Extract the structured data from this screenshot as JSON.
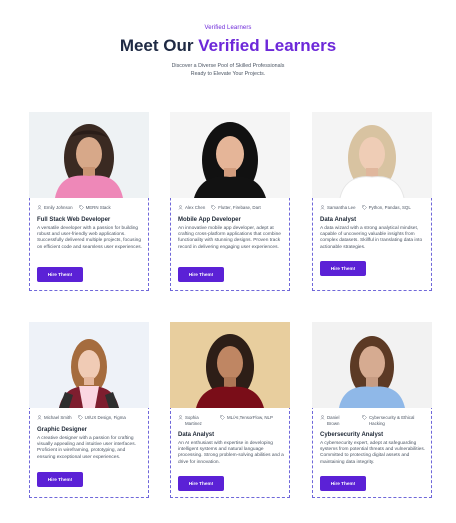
{
  "header": {
    "eyebrow": "Verified Learners",
    "title_prefix": "Meet Our ",
    "title_accent": "Verified Learners",
    "subtitle_line1": "Discover a Diverse Pool of Skilled Professionals",
    "subtitle_line2": "Ready to Elevate Your Projects."
  },
  "cards": [
    {
      "name": "Emily Johnson",
      "skills": "MERN Stack",
      "role": "Full Stack Web Developer",
      "description": "A versatile developer with a passion for building robust and user-friendly web applications. Successfully delivered multiple projects, focusing on efficient code and seamless user experiences.",
      "button": "Hire Them!"
    },
    {
      "name": "Alex Chen",
      "skills": "Flutter, Firebase, Dart",
      "role": "Mobile App Developer",
      "description": "An innovative mobile app developer, adept at crafting cross-platform applications that combine functionality with stunning designs. Proven track record in delivering engaging user experiences.",
      "button": "Hire Them!"
    },
    {
      "name": "Samantha Lee",
      "skills": "Python, Pandas, SQL",
      "role": "Data Analyst",
      "description": "A data wizard with a strong analytical mindset, capable of uncovering valuable insights from complex datasets. Skillful in translating data into actionable strategies.",
      "button": "Hire Them!"
    },
    {
      "name": "Michael Smith",
      "skills": "UI/UX Design, Figma",
      "role": "Graphic Designer",
      "description": "A creative designer with a passion for crafting visually appealing and intuitive user interfaces. Proficient in wireframing, prototyping, and ensuring exceptional user experiences.",
      "button": "Hire Them!"
    },
    {
      "name": "Sophia Martinez",
      "skills": "ML/AI,TensorFlow, NLP",
      "role": "Data Analyst",
      "description": "An AI enthusiast with expertise in developing intelligent systems and natural language processing. Strong problem-solving abilities and a drive for innovation.",
      "button": "Hire Them!"
    },
    {
      "name": "Daniel Brown",
      "skills": "Cybersecurity & Ethical Hacking",
      "role": "Cybersecurity Analyst",
      "description": "A cybersecurity expert, adept at safeguarding systems from potential threats and vulnerabilities. Committed to protecting digital assets and maintaining data integrity.",
      "button": "Hire Them!"
    }
  ]
}
